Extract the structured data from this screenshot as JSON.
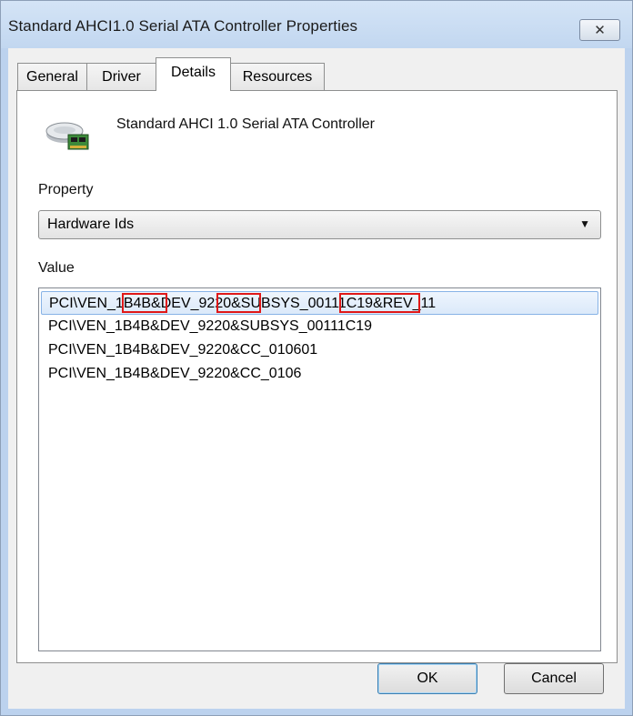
{
  "window": {
    "title": "Standard AHCI1.0 Serial ATA Controller Properties",
    "close_glyph": "✕"
  },
  "tabs": [
    {
      "label": "General",
      "active": false
    },
    {
      "label": "Driver",
      "active": false
    },
    {
      "label": "Details",
      "active": true
    },
    {
      "label": "Resources",
      "active": false
    }
  ],
  "device": {
    "name": "Standard AHCI 1.0 Serial ATA Controller",
    "icon": "controller-card-icon"
  },
  "property": {
    "label": "Property",
    "selected": "Hardware Ids"
  },
  "value": {
    "label": "Value",
    "items": [
      "PCI\\VEN_1B4B&DEV_9220&SUBSYS_00111C19&REV_11",
      "PCI\\VEN_1B4B&DEV_9220&SUBSYS_00111C19",
      "PCI\\VEN_1B4B&DEV_9220&CC_010601",
      "PCI\\VEN_1B4B&DEV_9220&CC_0106"
    ],
    "selected_index": 0
  },
  "buttons": {
    "ok": "OK",
    "cancel": "Cancel"
  },
  "colors": {
    "highlight_box": "#e01818",
    "selection": "#dbe9fa"
  }
}
